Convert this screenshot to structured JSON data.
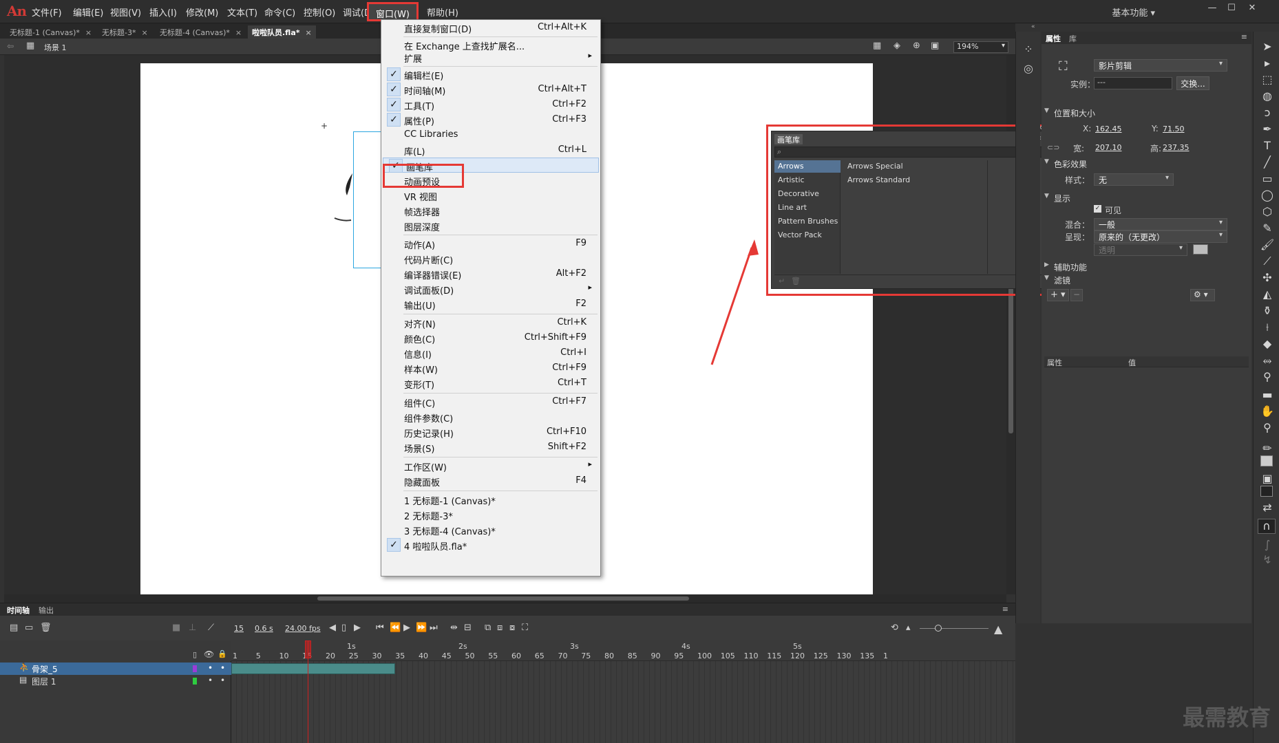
{
  "app": {
    "logo": "An"
  },
  "menubar": {
    "items": [
      "文件(F)",
      "编辑(E)",
      "视图(V)",
      "插入(I)",
      "修改(M)",
      "文本(T)",
      "命令(C)",
      "控制(O)",
      "调试(D)",
      "窗口(W)",
      "帮助(H)"
    ],
    "workspace": "基本功能 ▾",
    "win_min": "—",
    "win_max": "☐",
    "win_close": "✕"
  },
  "tabs": [
    {
      "label": "无标题-1 (Canvas)*",
      "close": "×"
    },
    {
      "label": "无标题-3*",
      "close": "×"
    },
    {
      "label": "无标题-4 (Canvas)*",
      "close": "×"
    },
    {
      "label": "啦啦队员.fla*",
      "close": "×"
    }
  ],
  "scenebar": {
    "scene_label": "场景 1",
    "zoom": "194%"
  },
  "window_menu": {
    "items": [
      {
        "label": "直接复制窗口(D)",
        "shortcut": "Ctrl+Alt+K"
      },
      {
        "label": "在 Exchange 上查找扩展名...",
        "shortcut": ""
      },
      {
        "label": "扩展",
        "shortcut": "",
        "arrow": "▸"
      },
      {
        "label": "编辑栏(E)",
        "shortcut": "",
        "check": "✓"
      },
      {
        "label": "时间轴(M)",
        "shortcut": "Ctrl+Alt+T",
        "check": "✓"
      },
      {
        "label": "工具(T)",
        "shortcut": "Ctrl+F2",
        "check": "✓"
      },
      {
        "label": "属性(P)",
        "shortcut": "Ctrl+F3",
        "check": "✓"
      },
      {
        "label": "CC Libraries",
        "shortcut": ""
      },
      {
        "label": "库(L)",
        "shortcut": "Ctrl+L"
      },
      {
        "label": "画笔库",
        "shortcut": "",
        "check": "✓"
      },
      {
        "label": "动画预设",
        "shortcut": ""
      },
      {
        "label": "VR 视图",
        "shortcut": ""
      },
      {
        "label": "帧选择器",
        "shortcut": ""
      },
      {
        "label": "图层深度",
        "shortcut": ""
      },
      {
        "label": "动作(A)",
        "shortcut": "F9"
      },
      {
        "label": "代码片断(C)",
        "shortcut": ""
      },
      {
        "label": "编译器错误(E)",
        "shortcut": "Alt+F2"
      },
      {
        "label": "调试面板(D)",
        "shortcut": "",
        "arrow": "▸"
      },
      {
        "label": "输出(U)",
        "shortcut": "F2"
      },
      {
        "label": "对齐(N)",
        "shortcut": "Ctrl+K"
      },
      {
        "label": "颜色(C)",
        "shortcut": "Ctrl+Shift+F9"
      },
      {
        "label": "信息(I)",
        "shortcut": "Ctrl+I"
      },
      {
        "label": "样本(W)",
        "shortcut": "Ctrl+F9"
      },
      {
        "label": "变形(T)",
        "shortcut": "Ctrl+T"
      },
      {
        "label": "组件(C)",
        "shortcut": "Ctrl+F7"
      },
      {
        "label": "组件参数(C)",
        "shortcut": ""
      },
      {
        "label": "历史记录(H)",
        "shortcut": "Ctrl+F10"
      },
      {
        "label": "场景(S)",
        "shortcut": "Shift+F2"
      },
      {
        "label": "工作区(W)",
        "shortcut": "",
        "arrow": "▸"
      },
      {
        "label": "隐藏面板",
        "shortcut": "F4"
      },
      {
        "label": "1 无标题-1 (Canvas)*",
        "shortcut": ""
      },
      {
        "label": "2 无标题-3*",
        "shortcut": ""
      },
      {
        "label": "3 无标题-4 (Canvas)*",
        "shortcut": ""
      },
      {
        "label": "4 啦啦队员.fla*",
        "shortcut": "",
        "check": "✓"
      }
    ]
  },
  "brush_panel": {
    "title": "画笔库",
    "categories": [
      "Arrows",
      "Artistic",
      "Decorative",
      "Line art",
      "Pattern Brushes",
      "Vector Pack"
    ],
    "selected_category": "Arrows",
    "subitems": [
      "Arrows Special",
      "Arrows Standard"
    ]
  },
  "properties": {
    "tabs": [
      "属性",
      "库"
    ],
    "instance_type": "影片剪辑",
    "instance_label": "实例：",
    "instance_value": "---",
    "swap_button": "交换...",
    "position_section": "位置和大小",
    "x_label": "X:",
    "x_value": "162.45",
    "y_label": "Y:",
    "y_value": "71.50",
    "w_label": "宽:",
    "w_value": "207.10",
    "h_label": "高:",
    "h_value": "237.35",
    "color_section": "色彩效果",
    "style_label": "样式：",
    "style_value": "无",
    "display_section": "显示",
    "visible_label": "可见",
    "blend_label": "混合：",
    "blend_value": "一般",
    "render_label": "呈现：",
    "render_value": "原来的（无更改）",
    "transparent_value": "透明",
    "a11y_section": "辅助功能",
    "filter_section": "滤镜",
    "filter_col1": "属性",
    "filter_col2": "值"
  },
  "timeline": {
    "tabs": [
      "时间轴",
      "输出"
    ],
    "frame": "15",
    "time": "0.6 s",
    "fps": "24.00 fps",
    "seconds": [
      "1s",
      "2s",
      "3s",
      "4s",
      "5s"
    ],
    "frame_numbers": [
      "1",
      "5",
      "10",
      "15",
      "20",
      "25",
      "30",
      "35",
      "40",
      "45",
      "50",
      "55",
      "60",
      "65",
      "70",
      "75",
      "80",
      "85",
      "90",
      "95",
      "100",
      "105",
      "110",
      "115",
      "120",
      "125",
      "130",
      "135",
      "1"
    ],
    "layers": [
      {
        "name": "骨架_5",
        "color": "#9b3cd8"
      },
      {
        "name": "图层 1",
        "color": "#2ecc40"
      }
    ]
  },
  "watermark": "最需教育",
  "colors": {
    "accent_red": "#e53935",
    "selection_blue": "#557394"
  }
}
